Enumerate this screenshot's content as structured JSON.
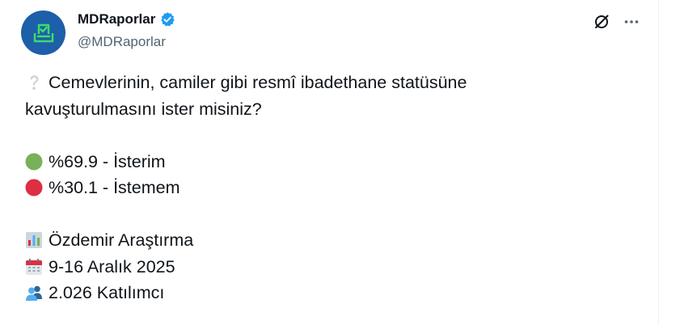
{
  "account": {
    "display_name": "MDRaporlar",
    "handle": "@MDRaporlar",
    "avatar_color": "#1d5fa8",
    "accent_color": "#3ddc6a",
    "verified_color": "#1d9bf0"
  },
  "actions": {
    "grok_icon": "grok-icon",
    "more_icon": "more-icon"
  },
  "tweet": {
    "question_line1": "Cemevlerinin, camiler gibi resmî ibadethane statüsüne",
    "question_line2": "kavuşturulmasını ister misiniz?",
    "results": [
      {
        "icon": "green-circle-icon",
        "text": "%69.9 - İsterim",
        "color": "#78b159"
      },
      {
        "icon": "red-circle-icon",
        "text": "%30.1 - İstemem",
        "color": "#dd2e44"
      }
    ],
    "source": {
      "icon": "bar-chart-icon",
      "text": "Özdemir Araştırma"
    },
    "date": {
      "icon": "calendar-icon",
      "text": "9-16 Aralık 2025"
    },
    "participants": {
      "icon": "people-icon",
      "text": "2.026 Katılımcı"
    }
  }
}
